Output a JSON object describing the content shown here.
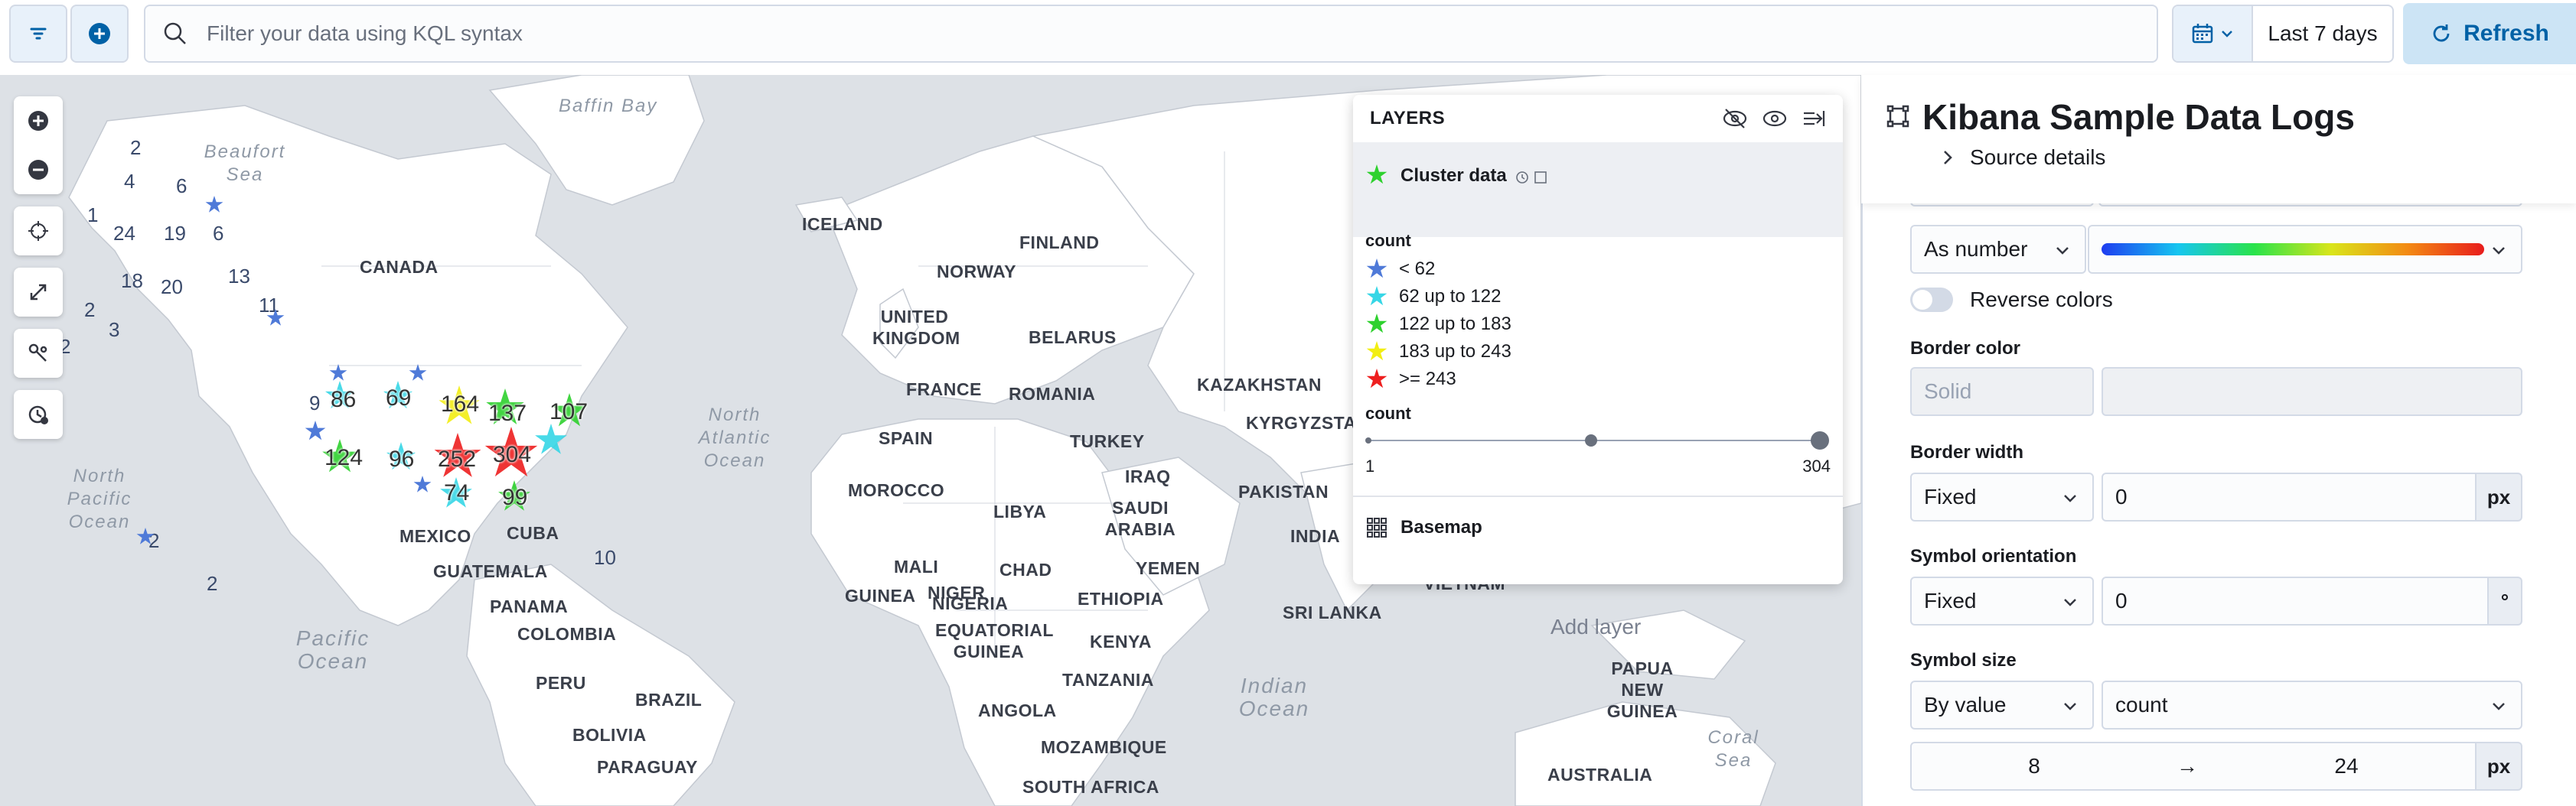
{
  "toolbar": {
    "kql_placeholder": "Filter your data using KQL syntax",
    "date_range": "Last 7 days",
    "refresh_label": "Refresh"
  },
  "map": {
    "countries": [
      "CANADA",
      "ICELAND",
      "NORWAY",
      "FINLAND",
      "UNITED KINGDOM",
      "BELARUS",
      "FRANCE",
      "ROMANIA",
      "KAZAKHSTAN",
      "SPAIN",
      "TURKEY",
      "KYRGYZSTAN",
      "MOROCCO",
      "LIBYA",
      "IRAQ",
      "SAUDI ARABIA",
      "PAKISTAN",
      "INDIA",
      "MEXICO",
      "CUBA",
      "GUATEMALA",
      "PANAMA",
      "COLOMBIA",
      "PERU",
      "BRAZIL",
      "BOLIVIA",
      "PARAGUAY",
      "MALI",
      "CHAD",
      "NIGER",
      "NIGERIA",
      "GUINEA",
      "EQUATORIAL GUINEA",
      "ETHIOPIA",
      "YEMEN",
      "KENYA",
      "TANZANIA",
      "ANGOLA",
      "MOZAMBIQUE",
      "SOUTH AFRICA",
      "SRI LANKA",
      "VIETNAM",
      "PAPUA NEW GUINEA",
      "AUSTRALIA"
    ],
    "oceans": {
      "baffin": "Baffin Bay",
      "beaufort": "Beaufort Sea",
      "north_pacific": "North Pacific Ocean",
      "north_atlantic": "North Atlantic Ocean",
      "pacific": "Pacific Ocean",
      "indian": "Indian Ocean",
      "coral": "Coral Sea"
    },
    "small_counts": [
      "2",
      "4",
      "6",
      "1",
      "24",
      "19",
      "6",
      "18",
      "20",
      "13",
      "2",
      "3",
      "11",
      "2",
      "9",
      "2",
      "2",
      "10"
    ],
    "cluster_counts": [
      "86",
      "69",
      "164",
      "137",
      "107",
      "124",
      "96",
      "252",
      "304",
      "74",
      "99"
    ]
  },
  "layers_panel": {
    "title": "LAYERS",
    "cluster_layer_name": "Cluster data",
    "legend_title_color": "count",
    "legend": [
      {
        "label": "< 62",
        "color": "#4f7ad8"
      },
      {
        "label": "62 up to 122",
        "color": "#36d6e6"
      },
      {
        "label": "122 up to 183",
        "color": "#2ed12e"
      },
      {
        "label": "183 up to 243",
        "color": "#f2ee12"
      },
      {
        "label": ">= 243",
        "color": "#ee1f1f"
      }
    ],
    "legend_title_size": "count",
    "size_min": "1",
    "size_max": "304",
    "basemap_name": "Basemap",
    "add_layer": "Add layer"
  },
  "right_panel": {
    "title": "Kibana Sample Data Logs",
    "source_details": "Source details",
    "color_as": "As number",
    "reverse_colors": "Reverse colors",
    "border_color_label": "Border color",
    "border_color_value": "Solid",
    "border_width_label": "Border width",
    "border_width_mode": "Fixed",
    "border_width_value": "0",
    "border_width_unit": "px",
    "orientation_label": "Symbol orientation",
    "orientation_mode": "Fixed",
    "orientation_value": "0",
    "orientation_unit": "°",
    "size_label": "Symbol size",
    "size_mode": "By value",
    "size_field": "count",
    "size_min": "8",
    "size_arrow": "→",
    "size_max": "24",
    "size_unit": "px"
  }
}
